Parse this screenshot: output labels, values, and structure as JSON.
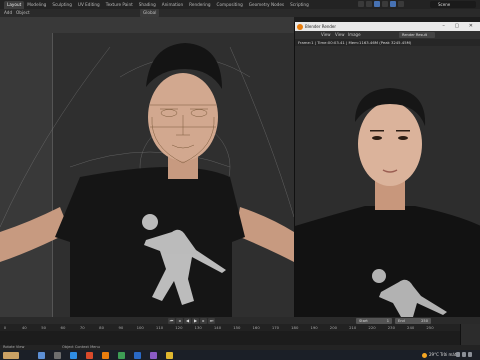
{
  "workspace_tabs": [
    "Layout",
    "Modeling",
    "Sculpting",
    "UV Editing",
    "Texture Paint",
    "Shading",
    "Animation",
    "Rendering",
    "Compositing",
    "Geometry Nodes",
    "Scripting"
  ],
  "active_tab": "Layout",
  "scene_name": "Scene",
  "viewport_header": {
    "menu_add": "Add",
    "menu_object": "Object",
    "orientation": "Global"
  },
  "render_window": {
    "title": "Blender Render",
    "menu": [
      "View",
      "View",
      "Image"
    ],
    "result_selector": "Render Result",
    "stats": "Frame:1 | Time:00:03.41 | Mem:1163.46M (Peak 3245.45M)"
  },
  "timeline": {
    "start_label": "Start",
    "start_value": "1",
    "end_label": "End",
    "end_value": "250",
    "ruler_ticks": [
      "0",
      "40",
      "50",
      "60",
      "70",
      "80",
      "90",
      "100",
      "110",
      "120",
      "130",
      "140",
      "150",
      "160",
      "170",
      "180",
      "190",
      "200",
      "210",
      "220",
      "230",
      "240",
      "250"
    ]
  },
  "statusbar": {
    "left": "Rotate View",
    "middle": "Object Context Menu"
  },
  "taskbar": {
    "weather": "29°C Trời mát"
  },
  "colors": {
    "accent": "#4772b3",
    "blender_orange": "#e87d0d",
    "ui_bg": "#232323"
  }
}
